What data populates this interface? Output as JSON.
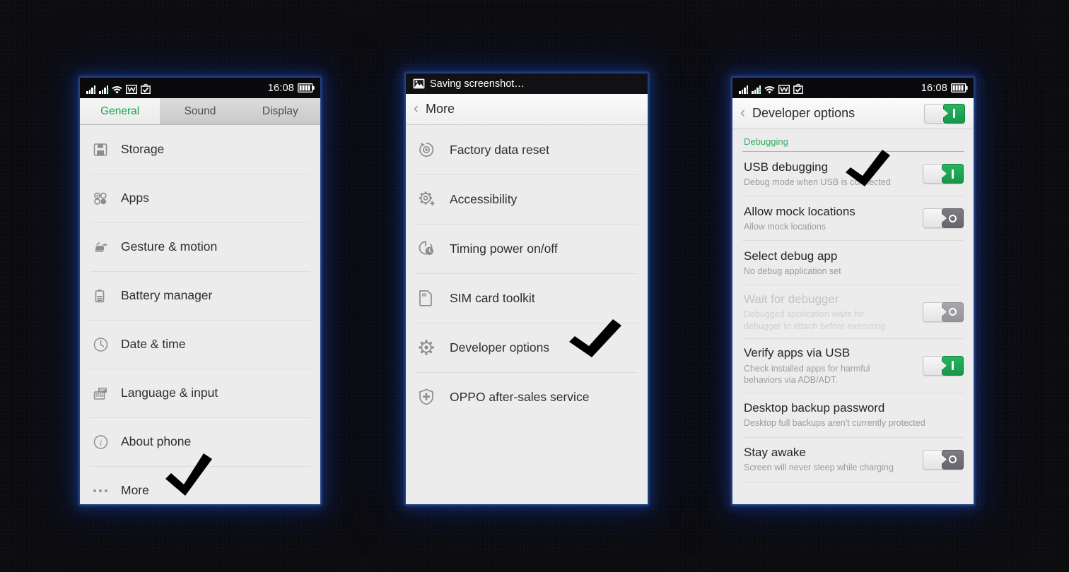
{
  "statusbar": {
    "time": "16:08",
    "icons": [
      "signal-bars-sim1-icon",
      "signal-bars-sim2-icon",
      "wifi-icon",
      "gmail-icon",
      "play-store-icon",
      "battery-icon"
    ],
    "battery_level": "4 bars"
  },
  "colors": {
    "accent_green": "#1aa64b",
    "section_green": "#2fae5e",
    "toggle_on": "#17964a",
    "toggle_off": "#65656b",
    "panel_bg": "#ececec",
    "statusbar_bg": "#0a0a0c",
    "glow": "#1e46aa"
  },
  "phone1": {
    "tabs": [
      {
        "label": "General",
        "active": true
      },
      {
        "label": "Sound",
        "active": false
      },
      {
        "label": "Display",
        "active": false
      }
    ],
    "items": [
      {
        "label": "Storage",
        "icon": "floppy-disk-icon"
      },
      {
        "label": "Apps",
        "icon": "apps-circles-icon"
      },
      {
        "label": "Gesture & motion",
        "icon": "hand-gesture-icon"
      },
      {
        "label": "Battery manager",
        "icon": "battery-icon"
      },
      {
        "label": "Date & time",
        "icon": "clock-icon"
      },
      {
        "label": "Language & input",
        "icon": "keyboard-icon"
      },
      {
        "label": "About phone",
        "icon": "info-circle-icon"
      },
      {
        "label": "More",
        "icon": "ellipsis-icon"
      }
    ],
    "annotation": "checkmark on More"
  },
  "phone2": {
    "notification": "Saving screenshot…",
    "notification_icon": "image-icon",
    "header": {
      "back": "‹",
      "title": "More"
    },
    "items": [
      {
        "label": "Factory data reset",
        "icon": "factory-reset-icon"
      },
      {
        "label": "Accessibility",
        "icon": "accessibility-gear-icon"
      },
      {
        "label": "Timing power on/off",
        "icon": "timer-power-icon"
      },
      {
        "label": "SIM card toolkit",
        "icon": "sim-card-icon"
      },
      {
        "label": "Developer options",
        "icon": "gear-icon"
      },
      {
        "label": "OPPO after-sales service",
        "icon": "shield-plus-icon"
      }
    ],
    "annotation": "checkmark on Developer options"
  },
  "phone3": {
    "header": {
      "back": "‹",
      "title": "Developer options",
      "toggle": "on"
    },
    "section": "Debugging",
    "rows": [
      {
        "title": "USB debugging",
        "subtitle": "Debug mode when USB is connected",
        "toggle": "on",
        "disabled": false
      },
      {
        "title": "Allow mock locations",
        "subtitle": "Allow mock locations",
        "toggle": "off",
        "disabled": false
      },
      {
        "title": "Select debug app",
        "subtitle": "No debug application set",
        "toggle": "none",
        "disabled": false
      },
      {
        "title": "Wait for debugger",
        "subtitle": "Debugged application waits for debugger to attach before executing",
        "toggle": "off",
        "disabled": true
      },
      {
        "title": "Verify apps via USB",
        "subtitle": "Check installed apps for harmful behaviors via ADB/ADT.",
        "toggle": "on",
        "disabled": false
      },
      {
        "title": "Desktop backup password",
        "subtitle": "Desktop full backups aren't currently protected",
        "toggle": "none",
        "disabled": false
      },
      {
        "title": "Stay awake",
        "subtitle": "Screen will never sleep while charging",
        "toggle": "off",
        "disabled": false
      }
    ],
    "annotation": "checkmark on USB debugging"
  }
}
